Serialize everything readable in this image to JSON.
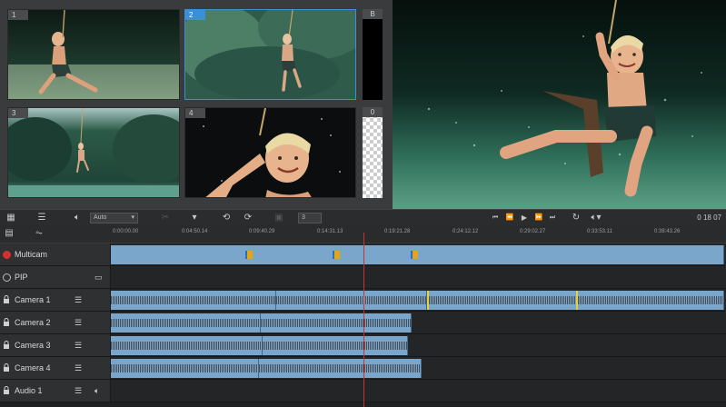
{
  "source_grid": {
    "tiles": [
      {
        "number": "1"
      },
      {
        "number": "2",
        "selected": true
      },
      {
        "number": "3"
      },
      {
        "number": "4"
      }
    ],
    "side_slots": [
      {
        "label": "B"
      },
      {
        "label": "0"
      }
    ]
  },
  "source_toolbar": {
    "audio_source_dropdown": "Auto",
    "number_field": "3"
  },
  "preview_toolbar": {
    "timecode": "0 18 07",
    "timecode_frames": "07"
  },
  "ruler": {
    "timecodes": [
      "0:00:00.00",
      "0:04:50.14",
      "0:09:40.29",
      "0:14:31.13",
      "0:19:21.28",
      "0:24:12.12",
      "0:29:02.27",
      "0:33:53.11",
      "0:38:43.26"
    ]
  },
  "tracks": [
    {
      "label": "Multicam",
      "type": "multicam"
    },
    {
      "label": "PIP",
      "type": "pip"
    },
    {
      "label": "Camera 1",
      "type": "camera"
    },
    {
      "label": "Camera 2",
      "type": "camera"
    },
    {
      "label": "Camera 3",
      "type": "camera"
    },
    {
      "label": "Camera 4",
      "type": "camera"
    },
    {
      "label": "Audio 1",
      "type": "audio"
    }
  ],
  "colors": {
    "clip": "#7ba6cc",
    "selection": "#3b8fd6",
    "playhead": "#c83232",
    "record": "#d23030"
  }
}
